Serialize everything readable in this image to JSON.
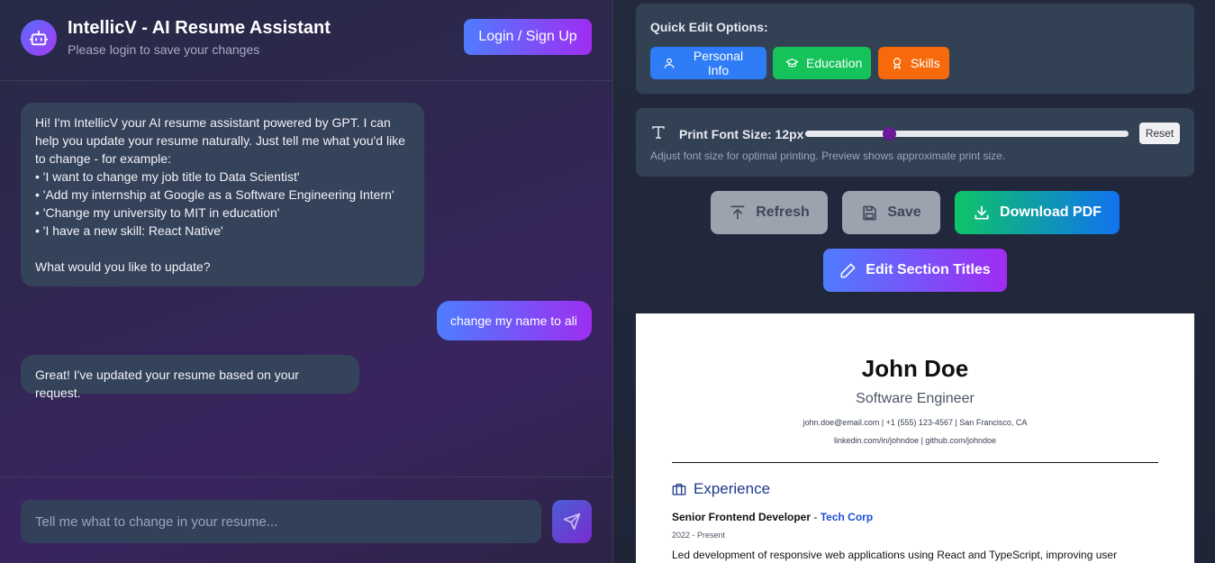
{
  "header": {
    "title": "IntellicV - AI Resume Assistant",
    "subtitle": "Please login to save your changes",
    "login_label": "Login / Sign Up"
  },
  "chat": {
    "messages": [
      {
        "role": "assistant",
        "lines": [
          "Hi! I'm IntellicV your AI resume assistant powered by GPT. I can",
          "help you update your resume naturally. Just tell me what you'd like",
          "to change - for example:",
          "• 'I want to change my job title to Data Scientist'",
          "• 'Add my internship at Google as a Software Engineering Intern'",
          "• 'Change my university to MIT in education'",
          "• 'I have a new skill: React Native'",
          "",
          "What would you like to update?"
        ]
      },
      {
        "role": "user",
        "lines": [
          "change my name to ali"
        ]
      },
      {
        "role": "assistant",
        "lines": [
          "Great! I've updated your resume based on your request."
        ]
      }
    ],
    "input_placeholder": "Tell me what to change in your resume..."
  },
  "quick_edit": {
    "title": "Quick Edit Options:",
    "buttons": [
      {
        "label": "Personal Info",
        "icon": "user-icon",
        "color": "#2e7cf6"
      },
      {
        "label": "Education",
        "icon": "graduation-cap-icon",
        "color": "#16c25a"
      },
      {
        "label": "Skills",
        "icon": "award-icon",
        "color": "#f66a0c"
      }
    ]
  },
  "font_size": {
    "label": "Print Font Size: 12px",
    "help": "Adjust font size for optimal printing. Preview shows approximate print size.",
    "slider_fraction": 0.26,
    "reset_label": "Reset"
  },
  "actions": {
    "refresh_label": "Refresh",
    "save_label": "Save",
    "download_label": "Download PDF",
    "edit_titles_label": "Edit Section Titles"
  },
  "resume": {
    "name": "John Doe",
    "title": "Software Engineer",
    "contact_line1": "john.doe@email.com | +1 (555) 123-4567 | San Francisco, CA",
    "contact_line2": "linkedin.com/in/johndoe | github.com/johndoe",
    "section_experience": "Experience",
    "job_title": "Senior Frontend Developer",
    "job_separator": " - ",
    "company": "Tech Corp",
    "dates": "2022 - Present",
    "description": "Led development of responsive web applications using React and TypeScript, improving user"
  },
  "colors": {
    "accent_gradient_start": "#4f7cff",
    "accent_gradient_end": "#a02cf2",
    "download_gradient_start": "#0ec467",
    "download_gradient_end": "#1172f0"
  }
}
